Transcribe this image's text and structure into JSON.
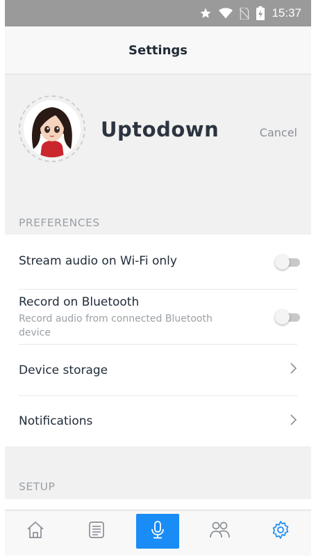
{
  "statusbar": {
    "time": "15:37",
    "icons": [
      "star-icon",
      "wifi-icon",
      "no-sim-icon",
      "battery-charging-icon"
    ]
  },
  "header": {
    "title": "Settings"
  },
  "profile": {
    "username": "Uptodown",
    "cancel_label": "Cancel"
  },
  "preferences": {
    "header": "PREFERENCES",
    "items": [
      {
        "title": "Stream audio on Wi-Fi only",
        "control": "toggle",
        "on": false
      },
      {
        "title": "Record on Bluetooth",
        "subtitle": "Record audio from connected Bluetooth device",
        "control": "toggle",
        "on": false
      },
      {
        "title": "Device storage",
        "control": "chevron"
      },
      {
        "title": "Notifications",
        "control": "chevron"
      }
    ]
  },
  "setup": {
    "header": "SETUP"
  },
  "nav": {
    "items": [
      "home-icon",
      "notes-icon",
      "microphone-icon",
      "people-icon",
      "settings-icon"
    ],
    "active": "microphone-icon"
  },
  "colors": {
    "accent": "#1a8cf5",
    "statusbar": "#9a9a9a",
    "nav_icon": "#8a8f96",
    "active_settings": "#1a8cf5"
  }
}
